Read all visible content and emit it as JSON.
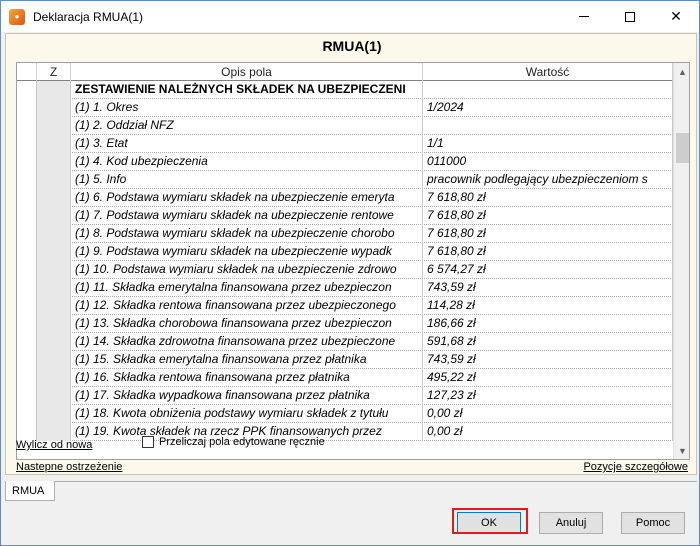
{
  "window": {
    "title": "Deklaracja RMUA(1)"
  },
  "form": {
    "title": "RMUA(1)"
  },
  "grid": {
    "headers": {
      "z": "Z",
      "desc": "Opis pola",
      "value": "Wartość"
    },
    "rows": [
      {
        "desc": "ZESTAWIENIE NALEŻNYCH SKŁADEK NA UBEZPIECZENI",
        "value": "",
        "section": true
      },
      {
        "desc": "(1) 1. Okres",
        "value": "1/2024"
      },
      {
        "desc": "(1) 2. Oddział NFZ",
        "value": ""
      },
      {
        "desc": "(1) 3. Etat",
        "value": "1/1"
      },
      {
        "desc": "(1) 4. Kod ubezpieczenia",
        "value": "011000"
      },
      {
        "desc": "(1) 5. Info",
        "value": "pracownik podlegający ubezpieczeniom s"
      },
      {
        "desc": "(1) 6. Podstawa wymiaru składek na ubezpieczenie emeryta",
        "value": "7 618,80 zł"
      },
      {
        "desc": "(1) 7. Podstawa wymiaru składek na ubezpieczenie rentowe",
        "value": "7 618,80 zł"
      },
      {
        "desc": "(1) 8. Podstawa wymiaru składek na ubezpieczenie chorobo",
        "value": "7 618,80 zł"
      },
      {
        "desc": "(1) 9. Podstawa wymiaru składek na ubezpieczenie wypadk",
        "value": "7 618,80 zł"
      },
      {
        "desc": "(1) 10. Podstawa wymiaru składek na ubezpieczenie zdrowo",
        "value": "6 574,27 zł"
      },
      {
        "desc": "(1) 11. Składka emerytalna finansowana przez ubezpieczon",
        "value": "743,59 zł"
      },
      {
        "desc": "(1) 12. Składka rentowa finansowana przez ubezpieczonego",
        "value": "114,28 zł"
      },
      {
        "desc": "(1) 13. Składka chorobowa finansowana przez ubezpieczon",
        "value": "186,66 zł"
      },
      {
        "desc": "(1) 14. Składka zdrowotna finansowana przez ubezpieczone",
        "value": "591,68 zł"
      },
      {
        "desc": "(1) 15. Składka emerytalna finansowana przez płatnika",
        "value": "743,59 zł"
      },
      {
        "desc": "(1) 16. Składka rentowa finansowana przez płatnika",
        "value": "495,22 zł"
      },
      {
        "desc": "(1) 17. Składka wypadkowa finansowana przez płatnika",
        "value": "127,23 zł"
      },
      {
        "desc": "(1) 18. Kwota obniżenia podstawy wymiaru składek z tytułu",
        "value": "0,00 zł"
      },
      {
        "desc": "(1) 19. Kwota składek na rzecz PPK finansowanych przez",
        "value": "0,00 zł"
      }
    ]
  },
  "links": {
    "recalc": "Wylicz od nowa",
    "next_warning": "Nastepne ostrzeżenie",
    "positions": "Pozycje szczegółowe"
  },
  "checkbox": {
    "label": "Przeliczaj pola edytowane ręcznie",
    "checked": false
  },
  "tabs": [
    "RMUA"
  ],
  "buttons": {
    "ok": "OK",
    "cancel": "Anuluj",
    "help": "Pomoc"
  }
}
